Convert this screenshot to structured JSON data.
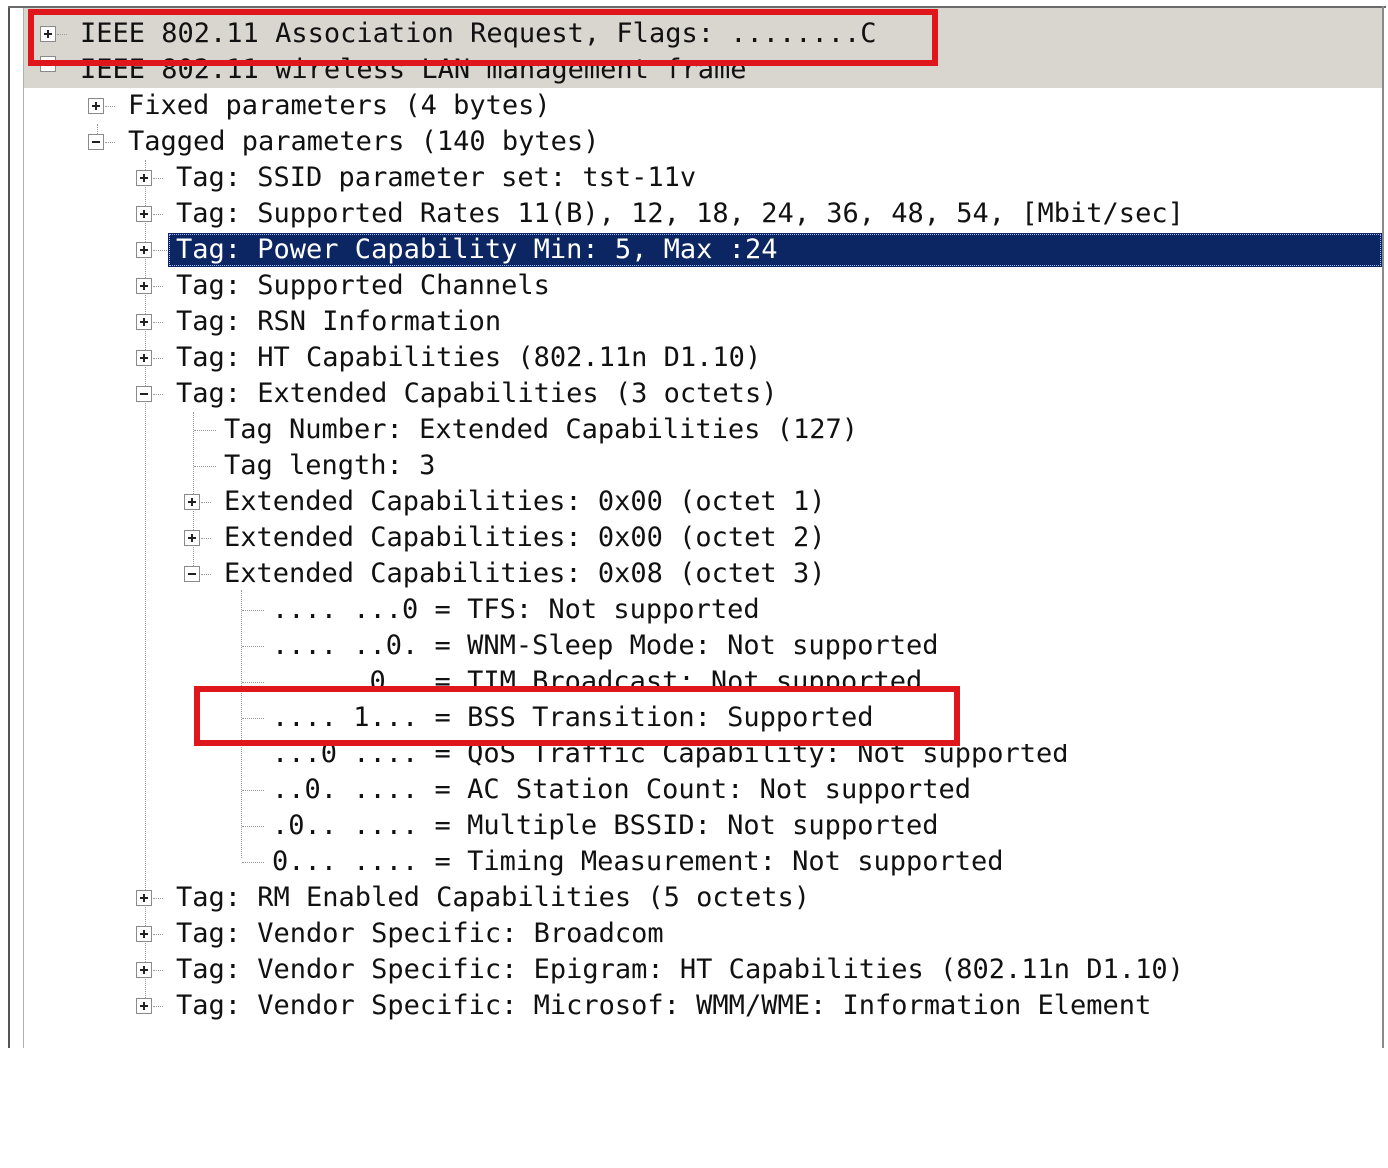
{
  "tree": {
    "top": "IEEE 802.11 Association Request, Flags: ........C",
    "mgmt": "IEEE 802.11 wireless LAN management frame",
    "fixed": "Fixed parameters (4 bytes)",
    "tagged": "Tagged parameters (140 bytes)",
    "ssid": "Tag: SSID parameter set: tst-11v",
    "rates": "Tag: Supported Rates 11(B), 12, 18, 24, 36, 48, 54, [Mbit/sec]",
    "power": "Tag: Power Capability Min: 5, Max :24",
    "channels": "Tag: Supported Channels",
    "rsn": "Tag: RSN Information",
    "ht": "Tag: HT Capabilities (802.11n D1.10)",
    "extcap": "Tag: Extended Capabilities (3 octets)",
    "tag_number": "Tag Number: Extended Capabilities (127)",
    "tag_length": "Tag length: 3",
    "octet1": "Extended Capabilities: 0x00 (octet 1)",
    "octet2": "Extended Capabilities: 0x00 (octet 2)",
    "octet3": "Extended Capabilities: 0x08 (octet 3)",
    "bit_tfs": ".... ...0 = TFS: Not supported",
    "bit_wnm": ".... ..0. = WNM-Sleep Mode: Not supported",
    "bit_tim": ".... .0.. = TIM Broadcast: Not supported",
    "bit_bss": ".... 1... = BSS Transition: Supported",
    "bit_qos": "...0 .... = QoS Traffic Capability: Not supported",
    "bit_ac": "..0. .... = AC Station Count: Not supported",
    "bit_mbssid": ".0.. .... = Multiple BSSID: Not supported",
    "bit_timing": "0... .... = Timing Measurement: Not supported",
    "rm": "Tag: RM Enabled Capabilities (5 octets)",
    "vendor_bcm": "Tag: Vendor Specific: Broadcom",
    "vendor_epigram": "Tag: Vendor Specific: Epigram: HT Capabilities (802.11n D1.10)",
    "vendor_ms": "Tag: Vendor Specific: Microsof: WMM/WME: Information Element"
  },
  "icons": {
    "expand": "plus-box-icon",
    "collapse": "minus-box-icon"
  },
  "colors": {
    "selection": "#0b2663",
    "highlight_box": "#e0161d",
    "header_band": "#d9d5cf"
  }
}
